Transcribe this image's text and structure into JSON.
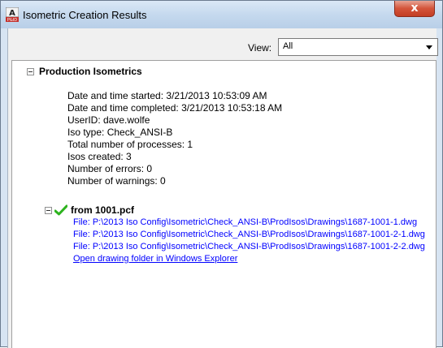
{
  "window": {
    "title": "Isometric Creation Results",
    "close_label": "x"
  },
  "view": {
    "label": "View:",
    "selected": "All"
  },
  "section": {
    "title": "Production Isometrics",
    "details": [
      "Date and time started: 3/21/2013 10:53:09 AM",
      "Date and time completed: 3/21/2013 10:53:18 AM",
      "UserID: dave.wolfe",
      "Iso type: Check_ANSI-B",
      "Total number of processes: 1",
      "Isos created: 3",
      "Number of errors: 0",
      "Number of warnings: 0"
    ]
  },
  "result": {
    "title": "from 1001.pcf",
    "status_icon": "check-icon",
    "files": [
      "File: P:\\2013 Iso Config\\Isometric\\Check_ANSI-B\\ProdIsos\\Drawings\\1687-1001-1.dwg",
      "File: P:\\2013 Iso Config\\Isometric\\Check_ANSI-B\\ProdIsos\\Drawings\\1687-1001-2-1.dwg",
      "File: P:\\2013 Iso Config\\Isometric\\Check_ANSI-B\\ProdIsos\\Drawings\\1687-1001-2-2.dwg"
    ],
    "open_folder_link": "Open drawing folder in Windows Explorer"
  },
  "colors": {
    "link": "#0000ff",
    "check": "#2db31e",
    "close": "#c94a30"
  }
}
